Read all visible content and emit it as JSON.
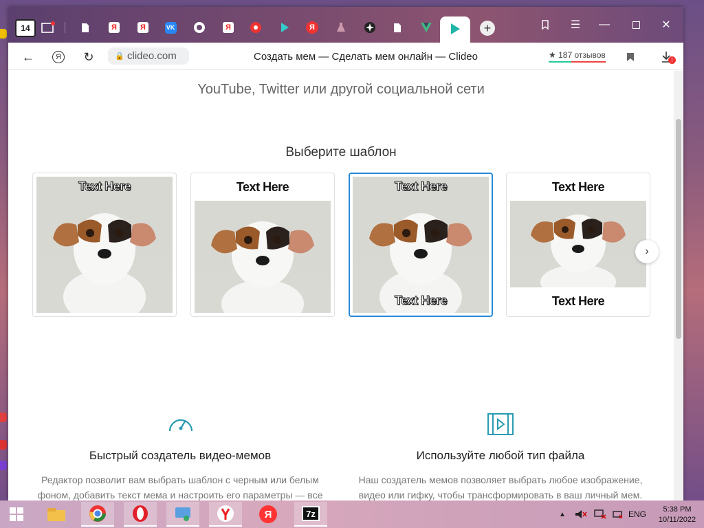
{
  "browser": {
    "tab_count": "14",
    "domain": "clideo.com",
    "page_title": "Создать мем — Сделать мем онлайн — Clideo",
    "reviews": "★ 187 отзывов",
    "download_badge": "!"
  },
  "page": {
    "subtitle": "YouTube, Twitter или другой социальной сети",
    "section_title": "Выберите шаблон",
    "templates": [
      {
        "top": "Text Here",
        "bottom": ""
      },
      {
        "top": "Text Here",
        "bottom": ""
      },
      {
        "top": "Text Here",
        "bottom": "Text Here"
      },
      {
        "top": "Text Here",
        "bottom": "Text Here"
      }
    ],
    "features": [
      {
        "title": "Быстрый создатель видео-мемов",
        "desc": "Редактор позволит вам выбрать шаблон с черным или белым фоном, добавить текст мема и настроить его параметры — все это на одном экране."
      },
      {
        "title": "Используйте любой тип файла",
        "desc": "Наш создатель мемов позволяет выбрать любое изображение, видео или гифку, чтобы трансформировать в ваш личный мем."
      }
    ]
  },
  "taskbar": {
    "lang": "ENG",
    "time": "5:38 PM",
    "date": "10/11/2022"
  },
  "colors": {
    "accent": "#2b8ad6",
    "icon_teal": "#2a9bb0"
  }
}
